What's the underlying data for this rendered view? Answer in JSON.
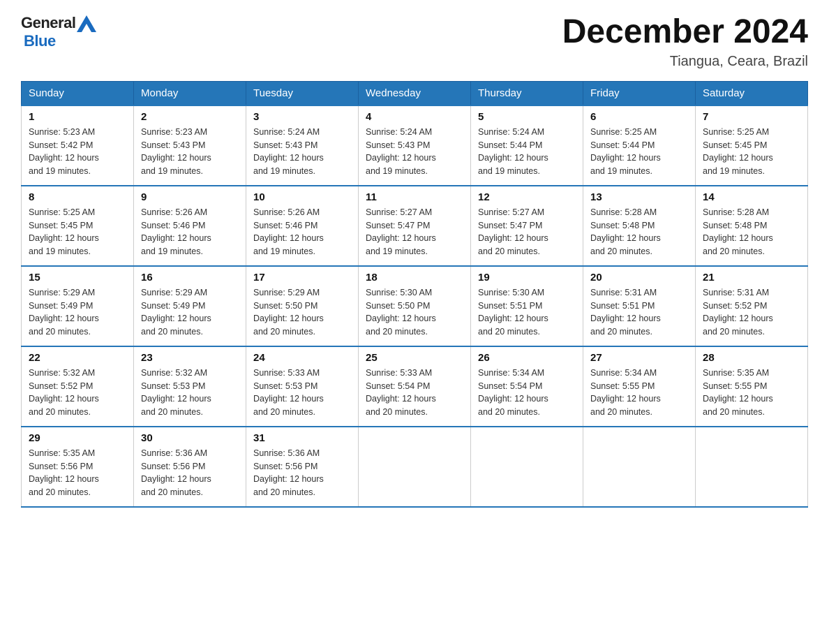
{
  "logo": {
    "text_general": "General",
    "text_blue": "Blue"
  },
  "title": "December 2024",
  "subtitle": "Tiangua, Ceara, Brazil",
  "weekdays": [
    "Sunday",
    "Monday",
    "Tuesday",
    "Wednesday",
    "Thursday",
    "Friday",
    "Saturday"
  ],
  "weeks": [
    [
      {
        "day": "1",
        "sunrise": "5:23 AM",
        "sunset": "5:42 PM",
        "daylight": "12 hours and 19 minutes."
      },
      {
        "day": "2",
        "sunrise": "5:23 AM",
        "sunset": "5:43 PM",
        "daylight": "12 hours and 19 minutes."
      },
      {
        "day": "3",
        "sunrise": "5:24 AM",
        "sunset": "5:43 PM",
        "daylight": "12 hours and 19 minutes."
      },
      {
        "day": "4",
        "sunrise": "5:24 AM",
        "sunset": "5:43 PM",
        "daylight": "12 hours and 19 minutes."
      },
      {
        "day": "5",
        "sunrise": "5:24 AM",
        "sunset": "5:44 PM",
        "daylight": "12 hours and 19 minutes."
      },
      {
        "day": "6",
        "sunrise": "5:25 AM",
        "sunset": "5:44 PM",
        "daylight": "12 hours and 19 minutes."
      },
      {
        "day": "7",
        "sunrise": "5:25 AM",
        "sunset": "5:45 PM",
        "daylight": "12 hours and 19 minutes."
      }
    ],
    [
      {
        "day": "8",
        "sunrise": "5:25 AM",
        "sunset": "5:45 PM",
        "daylight": "12 hours and 19 minutes."
      },
      {
        "day": "9",
        "sunrise": "5:26 AM",
        "sunset": "5:46 PM",
        "daylight": "12 hours and 19 minutes."
      },
      {
        "day": "10",
        "sunrise": "5:26 AM",
        "sunset": "5:46 PM",
        "daylight": "12 hours and 19 minutes."
      },
      {
        "day": "11",
        "sunrise": "5:27 AM",
        "sunset": "5:47 PM",
        "daylight": "12 hours and 19 minutes."
      },
      {
        "day": "12",
        "sunrise": "5:27 AM",
        "sunset": "5:47 PM",
        "daylight": "12 hours and 20 minutes."
      },
      {
        "day": "13",
        "sunrise": "5:28 AM",
        "sunset": "5:48 PM",
        "daylight": "12 hours and 20 minutes."
      },
      {
        "day": "14",
        "sunrise": "5:28 AM",
        "sunset": "5:48 PM",
        "daylight": "12 hours and 20 minutes."
      }
    ],
    [
      {
        "day": "15",
        "sunrise": "5:29 AM",
        "sunset": "5:49 PM",
        "daylight": "12 hours and 20 minutes."
      },
      {
        "day": "16",
        "sunrise": "5:29 AM",
        "sunset": "5:49 PM",
        "daylight": "12 hours and 20 minutes."
      },
      {
        "day": "17",
        "sunrise": "5:29 AM",
        "sunset": "5:50 PM",
        "daylight": "12 hours and 20 minutes."
      },
      {
        "day": "18",
        "sunrise": "5:30 AM",
        "sunset": "5:50 PM",
        "daylight": "12 hours and 20 minutes."
      },
      {
        "day": "19",
        "sunrise": "5:30 AM",
        "sunset": "5:51 PM",
        "daylight": "12 hours and 20 minutes."
      },
      {
        "day": "20",
        "sunrise": "5:31 AM",
        "sunset": "5:51 PM",
        "daylight": "12 hours and 20 minutes."
      },
      {
        "day": "21",
        "sunrise": "5:31 AM",
        "sunset": "5:52 PM",
        "daylight": "12 hours and 20 minutes."
      }
    ],
    [
      {
        "day": "22",
        "sunrise": "5:32 AM",
        "sunset": "5:52 PM",
        "daylight": "12 hours and 20 minutes."
      },
      {
        "day": "23",
        "sunrise": "5:32 AM",
        "sunset": "5:53 PM",
        "daylight": "12 hours and 20 minutes."
      },
      {
        "day": "24",
        "sunrise": "5:33 AM",
        "sunset": "5:53 PM",
        "daylight": "12 hours and 20 minutes."
      },
      {
        "day": "25",
        "sunrise": "5:33 AM",
        "sunset": "5:54 PM",
        "daylight": "12 hours and 20 minutes."
      },
      {
        "day": "26",
        "sunrise": "5:34 AM",
        "sunset": "5:54 PM",
        "daylight": "12 hours and 20 minutes."
      },
      {
        "day": "27",
        "sunrise": "5:34 AM",
        "sunset": "5:55 PM",
        "daylight": "12 hours and 20 minutes."
      },
      {
        "day": "28",
        "sunrise": "5:35 AM",
        "sunset": "5:55 PM",
        "daylight": "12 hours and 20 minutes."
      }
    ],
    [
      {
        "day": "29",
        "sunrise": "5:35 AM",
        "sunset": "5:56 PM",
        "daylight": "12 hours and 20 minutes."
      },
      {
        "day": "30",
        "sunrise": "5:36 AM",
        "sunset": "5:56 PM",
        "daylight": "12 hours and 20 minutes."
      },
      {
        "day": "31",
        "sunrise": "5:36 AM",
        "sunset": "5:56 PM",
        "daylight": "12 hours and 20 minutes."
      },
      null,
      null,
      null,
      null
    ]
  ],
  "labels": {
    "sunrise": "Sunrise:",
    "sunset": "Sunset:",
    "daylight": "Daylight:"
  }
}
